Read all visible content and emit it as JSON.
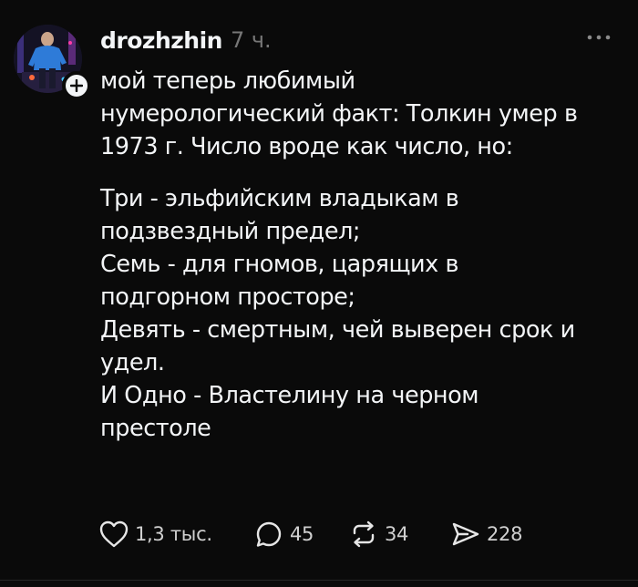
{
  "post": {
    "username": "drozhzhin",
    "timestamp": "7 ч.",
    "intro": "мой теперь любимый\nнумерологический факт: Толкин умер в\n1973 г. Число вроде как число, но:",
    "verse": "Три - эльфийским владыкам в\nподзвездный предел;\nСемь - для гномов, царящих в\nподгорном просторе;\nДевять - смертным, чей выверен срок и\nудел.\nИ Одно - Властелину на черном\nпрестоле"
  },
  "actions": {
    "likes": "1,3 тыс.",
    "replies": "45",
    "reposts": "34",
    "shares": "228"
  },
  "icons": {
    "follow": "plus-icon",
    "more": "more-horizontal-icon",
    "like": "heart-icon",
    "reply": "speech-bubble-icon",
    "repost": "repost-arrows-icon",
    "share": "send-icon"
  },
  "colors": {
    "background": "#0a0a0a",
    "text": "#f3f5f7",
    "muted": "#777777"
  }
}
